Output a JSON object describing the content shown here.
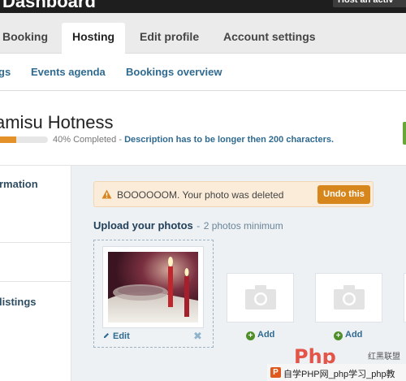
{
  "header": {
    "brand": "Dashboard",
    "host_button": "Host an activ"
  },
  "main_nav": {
    "tabs": [
      {
        "label": "Booking",
        "active": false
      },
      {
        "label": "Hosting",
        "active": true
      },
      {
        "label": "Edit profile",
        "active": false
      },
      {
        "label": "Account settings",
        "active": false
      }
    ]
  },
  "sub_nav": {
    "items": [
      "gs",
      "Events agenda",
      "Bookings overview"
    ]
  },
  "listing": {
    "title": "amisu Hotness",
    "progress_percent": 40,
    "progress_text": "40% Completed",
    "separator": "-",
    "description_warning": "Description has to be longer then 200 characters."
  },
  "sidebar": {
    "items": [
      "rmation",
      "listings"
    ]
  },
  "alert": {
    "message": "BOOOOOOM. Your photo was deleted",
    "undo_label": "Undo this"
  },
  "upload": {
    "heading": "Upload your photos",
    "separator": "-",
    "subheading": "2 photos minimum",
    "edit_label": "Edit",
    "remove_label": "✖",
    "add_label": "Add"
  },
  "watermark": {
    "logo_text": "Php",
    "cn_text": "红黑联盟",
    "bar_text": "自学PHP网_php学习_php教"
  },
  "colors": {
    "link_blue": "#2f6a90",
    "accent_orange": "#e4912a",
    "undo_orange": "#d7861c",
    "add_green": "#4e8f2a",
    "content_bg": "#edf1f4"
  }
}
